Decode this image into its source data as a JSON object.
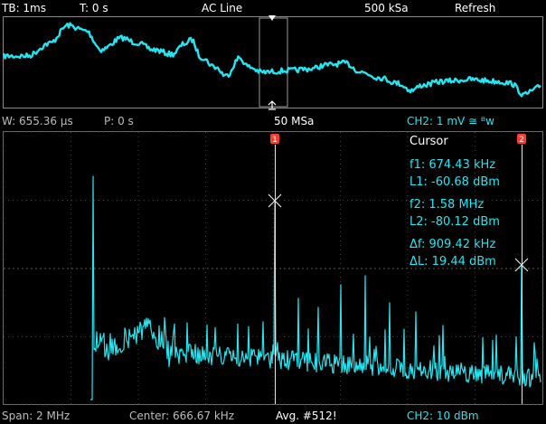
{
  "top_bar": {
    "timebase": "TB: 1ms",
    "trigger_time": "T: 0 s",
    "trigger_source": "AC Line",
    "sample_rate": "500 kSa",
    "acq_mode": "Refresh"
  },
  "mid_bar": {
    "window": "W: 655.36 µs",
    "position": "P: 0 s",
    "fft_sample_rate": "50 MSa",
    "channel_scale": "CH2: 1 mV ≅ ᴮw"
  },
  "bottom_bar": {
    "span": "Span: 2 MHz",
    "center": "Center: 666.67 kHz",
    "average": "Avg. #512!",
    "channel_ref": "CH2: 10 dBm"
  },
  "cursor_panel": {
    "title": "Cursor",
    "f1": "f1: 674.43 kHz",
    "l1": "L1: -60.68 dBm",
    "f2": "f2: 1.58 MHz",
    "l2": "L2: -80.12 dBm",
    "df": "Δf: 909.42 kHz",
    "dl": "ΔL: 19.44 dBm",
    "marker1_label": "1",
    "marker2_label": "2"
  },
  "colors": {
    "trace": "#22e6f2",
    "grid": "#555555",
    "marker": "#ff3b30",
    "text": "#ffffff"
  }
}
